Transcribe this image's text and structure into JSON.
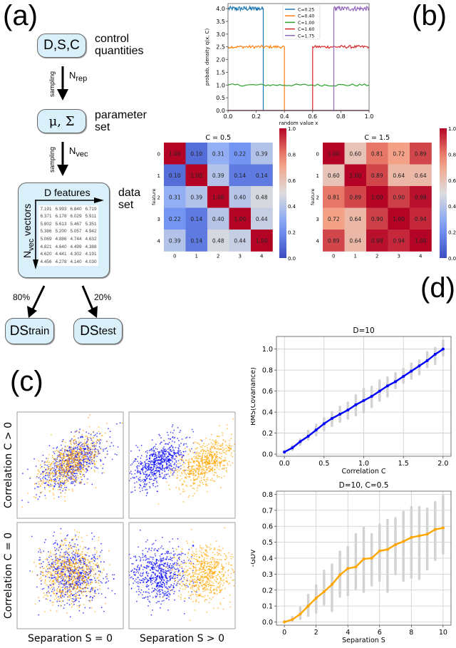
{
  "panels": {
    "a": "(a)",
    "b": "(b)",
    "c": "(c)",
    "d": "(d)"
  },
  "panel_a": {
    "box_dsc": "D,S,C",
    "label_dsc": [
      "control",
      "quantities"
    ],
    "arrow1_side": "sampling",
    "arrow1_n": "N",
    "arrow1_sub": "rep",
    "box_params": "μ, Σ",
    "label_params": [
      "parameter",
      "set"
    ],
    "arrow2_side": "sampling",
    "arrow2_n": "N",
    "arrow2_sub": "vec",
    "dataset_header": "D features",
    "dataset_side_n": "N",
    "dataset_side_sub": "vec",
    "dataset_side_rest": " vectors",
    "label_dataset": [
      "data",
      "set"
    ],
    "dataset_values": [
      [
        "7.191",
        "6.993",
        "6.840",
        "6.719"
      ],
      [
        "6.371",
        "6.178",
        "6.029",
        "5.911"
      ],
      [
        "5.802",
        "5.613",
        "5.467",
        "5.351"
      ],
      [
        "5.386",
        "5.200",
        "5.057",
        "4.942"
      ],
      [
        "5.069",
        "4.886",
        "4.744",
        "4.632"
      ],
      [
        "4.821",
        "4.640",
        "4.499",
        "4.388"
      ],
      [
        "4.620",
        "4.441",
        "4.302",
        "4.191"
      ],
      [
        "4.456",
        "4.278",
        "4.140",
        "4.030"
      ]
    ],
    "split_train_pct": "80%",
    "split_test_pct": "20%",
    "train_main": "DS",
    "train_sub": "train",
    "test_main": "DS",
    "test_sub": "test"
  },
  "panel_c": {
    "row_labels": [
      "Correlation C > 0",
      "Correlation C = 0"
    ],
    "col_labels": [
      "Separation S = 0",
      "Separation S > 0"
    ],
    "colors": {
      "class_a": "#0000ff",
      "class_b": "#ffa500"
    }
  },
  "chart_data": [
    {
      "id": "density",
      "type": "line",
      "title": "",
      "xlabel": "random value x",
      "ylabel": "probab. density q(x, C)",
      "xlim": [
        0,
        1
      ],
      "ylim": [
        0,
        4.2
      ],
      "xticks": [
        "0.0",
        "0.2",
        "0.4",
        "0.6",
        "0.8",
        "1.0"
      ],
      "yticks": [
        "0.0",
        "0.5",
        "1.0",
        "1.5",
        "2.0",
        "2.5",
        "3.0",
        "3.5",
        "4.0"
      ],
      "legend_position": "top-center",
      "series": [
        {
          "name": "C=0.25",
          "color": "#1f77b4",
          "support": [
            0,
            0.25
          ],
          "density": 4.0
        },
        {
          "name": "C=0.40",
          "color": "#ff7f0e",
          "support": [
            0,
            0.4
          ],
          "density": 2.5
        },
        {
          "name": "C=1.00",
          "color": "#2ca02c",
          "support": [
            0,
            1.0
          ],
          "density": 1.0
        },
        {
          "name": "C=1.60",
          "color": "#d62728",
          "support": [
            0.6,
            1.0
          ],
          "density": 2.5
        },
        {
          "name": "C=1.75",
          "color": "#9467bd",
          "support": [
            0.75,
            1.0
          ],
          "density": 4.0
        }
      ]
    },
    {
      "id": "heatmap_c05",
      "type": "heatmap",
      "title": "C = 0.5",
      "xlabel": "feature",
      "ylabel": "feature",
      "ticks": [
        "0",
        "1",
        "2",
        "3",
        "4"
      ],
      "colorbar_ticks": [
        "0.0",
        "0.2",
        "0.4",
        "0.6",
        "0.8",
        "1.0"
      ],
      "vmin": 0,
      "vmax": 1,
      "values": [
        [
          1.0,
          0.1,
          0.31,
          0.22,
          0.39
        ],
        [
          0.1,
          1.0,
          0.39,
          0.14,
          0.14
        ],
        [
          0.31,
          0.39,
          1.0,
          0.4,
          0.48
        ],
        [
          0.22,
          0.14,
          0.4,
          1.0,
          0.44
        ],
        [
          0.39,
          0.14,
          0.48,
          0.44,
          1.0
        ]
      ]
    },
    {
      "id": "heatmap_c15",
      "type": "heatmap",
      "title": "C = 1.5",
      "xlabel": "feature",
      "ylabel": "feature",
      "ticks": [
        "0",
        "1",
        "2",
        "3",
        "4"
      ],
      "colorbar_ticks": [
        "0.0",
        "0.2",
        "0.4",
        "0.6",
        "0.8",
        "1.0"
      ],
      "vmin": 0,
      "vmax": 1,
      "values": [
        [
          1.0,
          0.6,
          0.81,
          0.72,
          0.89
        ],
        [
          0.6,
          1.0,
          0.89,
          0.64,
          0.64
        ],
        [
          0.81,
          0.89,
          1.0,
          0.9,
          0.98
        ],
        [
          0.72,
          0.64,
          0.9,
          1.0,
          0.94
        ],
        [
          0.89,
          0.64,
          0.98,
          0.94,
          1.0
        ]
      ]
    },
    {
      "id": "rms_cov",
      "type": "line",
      "title": "D=10",
      "xlabel": "Correlation C",
      "ylabel": "RMS(Covariance)",
      "xlim": [
        -0.1,
        2.1
      ],
      "ylim": [
        -0.02,
        1.12
      ],
      "grid": true,
      "xticks": [
        "0.0",
        "0.5",
        "1.0",
        "1.5",
        "2.0"
      ],
      "yticks": [
        "0.0",
        "0.2",
        "0.4",
        "0.6",
        "0.8",
        "1.0"
      ],
      "line_color": "#0000ff",
      "scatter_color": "#d3d3d3",
      "x": [
        0.0,
        0.1,
        0.2,
        0.3,
        0.4,
        0.5,
        0.6,
        0.7,
        0.8,
        0.9,
        1.0,
        1.1,
        1.2,
        1.3,
        1.4,
        1.5,
        1.6,
        1.7,
        1.8,
        1.9,
        2.0
      ],
      "y": [
        0.02,
        0.06,
        0.12,
        0.17,
        0.23,
        0.29,
        0.34,
        0.38,
        0.42,
        0.47,
        0.51,
        0.55,
        0.6,
        0.65,
        0.69,
        0.74,
        0.79,
        0.84,
        0.89,
        0.95,
        1.0
      ],
      "spread_low": [
        0.01,
        0.04,
        0.09,
        0.14,
        0.18,
        0.23,
        0.27,
        0.31,
        0.34,
        0.37,
        0.4,
        0.45,
        0.51,
        0.55,
        0.63,
        0.68,
        0.72,
        0.76,
        0.83,
        0.86,
        0.94
      ],
      "spread_high": [
        0.03,
        0.08,
        0.14,
        0.22,
        0.28,
        0.34,
        0.4,
        0.45,
        0.49,
        0.56,
        0.62,
        0.64,
        0.7,
        0.73,
        0.77,
        0.81,
        0.86,
        0.89,
        0.97,
        1.01,
        1.08
      ]
    },
    {
      "id": "gdv",
      "type": "line",
      "title": "D=10, C=0.5",
      "xlabel": "Separation S",
      "ylabel": "-GDV",
      "xlim": [
        -0.5,
        10.5
      ],
      "ylim": [
        -0.02,
        0.82
      ],
      "grid": true,
      "xticks": [
        "0",
        "2",
        "4",
        "6",
        "8",
        "10"
      ],
      "yticks": [
        "0.0",
        "0.1",
        "0.2",
        "0.3",
        "0.4",
        "0.5",
        "0.6",
        "0.7",
        "0.8"
      ],
      "line_color": "#ffa500",
      "scatter_color": "#d3d3d3",
      "x": [
        0,
        0.5,
        1,
        1.5,
        2,
        2.5,
        3,
        3.5,
        4,
        4.5,
        5,
        5.5,
        6,
        6.5,
        7,
        7.5,
        8,
        8.5,
        9,
        9.5,
        10
      ],
      "y": [
        0.0,
        0.015,
        0.05,
        0.1,
        0.15,
        0.19,
        0.235,
        0.295,
        0.335,
        0.345,
        0.395,
        0.4,
        0.445,
        0.455,
        0.485,
        0.505,
        0.53,
        0.54,
        0.55,
        0.58,
        0.59
      ],
      "spread_low": [
        0.0,
        0.01,
        0.02,
        0.04,
        0.06,
        0.11,
        0.07,
        0.16,
        0.17,
        0.21,
        0.19,
        0.23,
        0.26,
        0.19,
        0.3,
        0.26,
        0.28,
        0.27,
        0.33,
        0.39,
        0.43
      ],
      "spread_high": [
        0.005,
        0.03,
        0.09,
        0.17,
        0.23,
        0.32,
        0.36,
        0.44,
        0.47,
        0.55,
        0.59,
        0.55,
        0.61,
        0.64,
        0.65,
        0.69,
        0.72,
        0.72,
        0.71,
        0.75,
        0.79
      ]
    }
  ]
}
